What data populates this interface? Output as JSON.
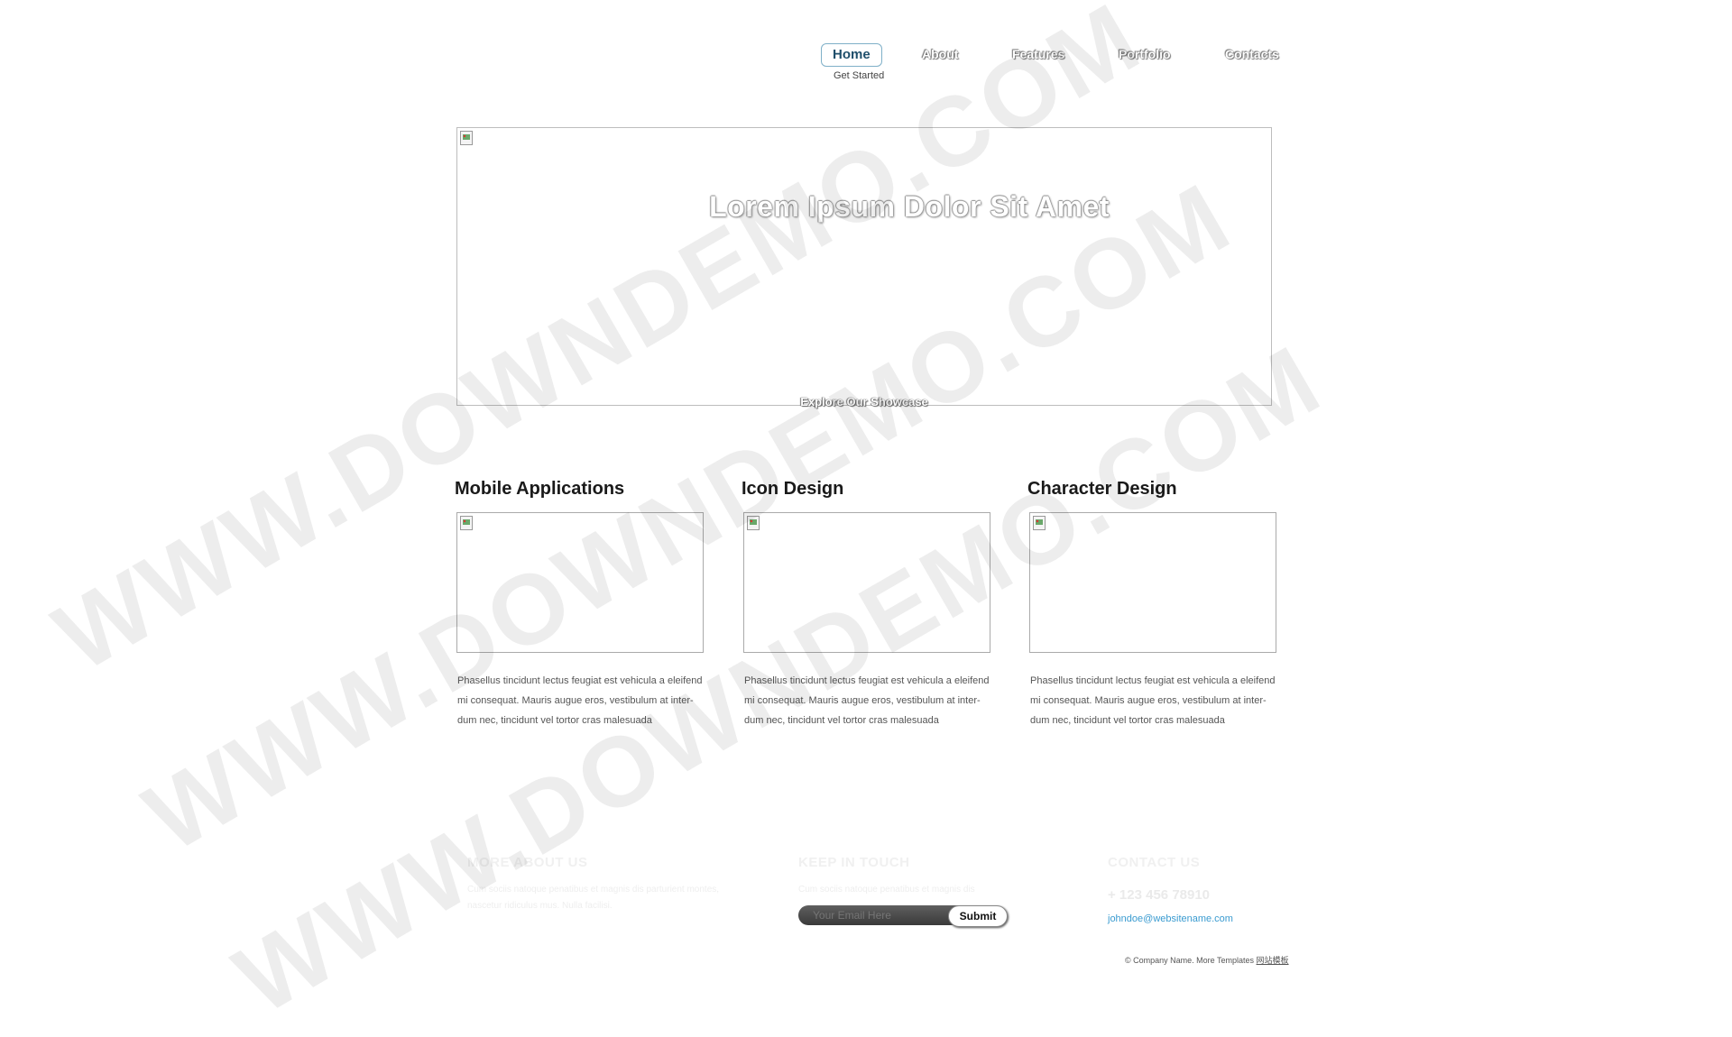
{
  "nav": {
    "items": [
      {
        "label": "Home",
        "active": true
      },
      {
        "label": "About"
      },
      {
        "label": "Features"
      },
      {
        "label": "Portfolio"
      },
      {
        "label": "Contacts"
      }
    ],
    "sub_label": "Get Started"
  },
  "hero": {
    "title": "Lorem Ipsum Dolor Sit Amet",
    "link": "Explore Our Showcase"
  },
  "columns": [
    {
      "title": "Mobile Applications",
      "text": "Phasellus tincidunt lectus feugiat est vehicula a eleifend mi consequat. Mauris augue eros, vestibulum at inter-dum nec, tincidunt vel tortor cras malesuada"
    },
    {
      "title": "Icon Design",
      "text": "Phasellus tincidunt lectus feugiat est vehicula a eleifend mi consequat. Mauris augue eros, vestibulum at inter-dum nec, tincidunt vel tortor cras malesuada"
    },
    {
      "title": "Character Design",
      "text": "Phasellus tincidunt lectus feugiat est vehicula a eleifend mi consequat. Mauris augue eros, vestibulum at inter-dum nec, tincidunt vel tortor cras malesuada"
    }
  ],
  "footer": {
    "about_heading": "MORE ABOUT US",
    "about_text": "Cum sociis natoque penatibus et magnis dis parturient montes, nascetur ridiculus mus. Nulla facilisi.",
    "touch_heading": "KEEP IN TOUCH",
    "touch_text": "Cum sociis natoque penatibus et magnis dis",
    "email_placeholder": "Your Email Here",
    "submit_label": "Submit",
    "contact_heading": "CONTACT US",
    "phone": "+ 123 456 78910",
    "email": "johndoe@websitename.com",
    "copyright": "© Company Name. More Templates",
    "copyright_link": "网站模板"
  },
  "watermark": "WWW.DOWNDEMO.COM",
  "colors": {
    "nav_active_text": "#1f4f6b",
    "nav_active_border": "#7fb0c8",
    "link_blue": "#3a9bd0"
  }
}
